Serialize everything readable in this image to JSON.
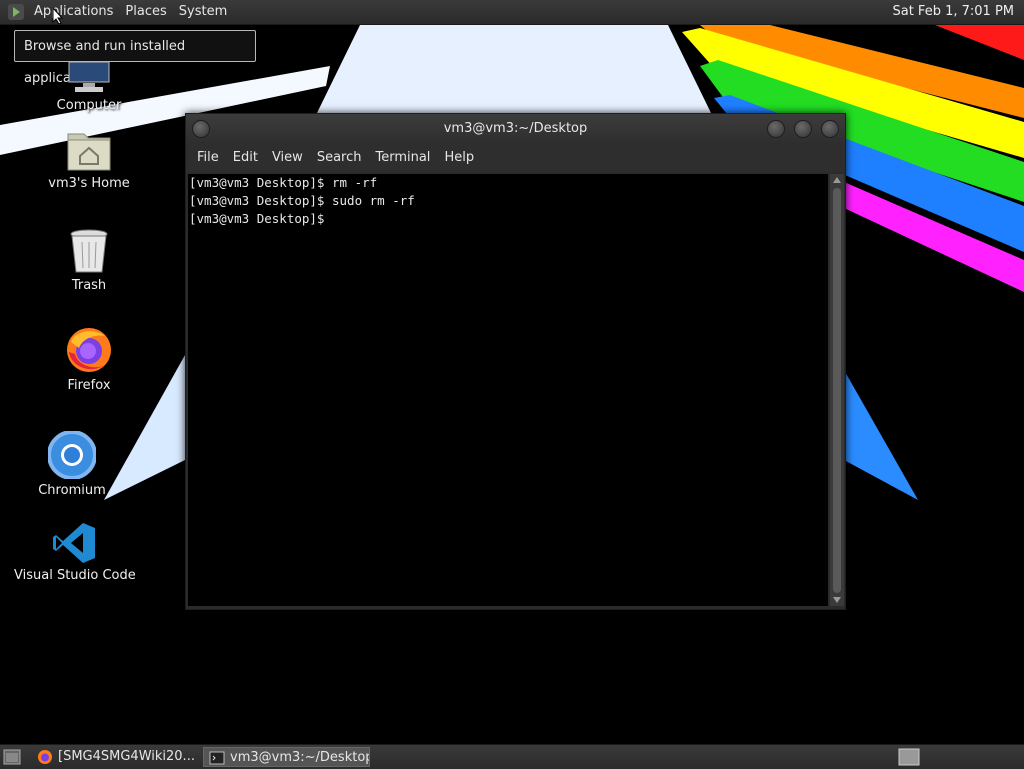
{
  "top_panel": {
    "menus": [
      "Applications",
      "Places",
      "System"
    ],
    "clock": "Sat Feb 1, 7:01 PM"
  },
  "tooltip": "Browse and run installed applications",
  "desktop_icons": [
    {
      "label": "Computer",
      "icon": "computer-icon"
    },
    {
      "label": "vm3's Home",
      "icon": "home-folder-icon"
    },
    {
      "label": "Trash",
      "icon": "trash-icon"
    },
    {
      "label": "Firefox",
      "icon": "firefox-icon"
    },
    {
      "label": "Chromium",
      "icon": "chromium-icon"
    },
    {
      "label": "Visual Studio Code",
      "icon": "vscode-icon"
    }
  ],
  "terminal": {
    "title": "vm3@vm3:~/Desktop",
    "menu": [
      "File",
      "Edit",
      "View",
      "Search",
      "Terminal",
      "Help"
    ],
    "lines": [
      "[vm3@vm3 Desktop]$ rm -rf",
      "[vm3@vm3 Desktop]$ sudo rm -rf",
      "[vm3@vm3 Desktop]$ "
    ]
  },
  "taskbar": {
    "tasks": [
      {
        "label": "[SMG4SMG4Wiki20...",
        "icon": "firefox-icon"
      },
      {
        "label": "vm3@vm3:~/Desktop",
        "icon": "terminal-icon"
      }
    ]
  },
  "colors": {
    "panel": "#2e2e2e",
    "stripes": [
      "#ff1a1a",
      "#ff8c00",
      "#ffff00",
      "#22dd22",
      "#1e7fff",
      "#ff22ff"
    ]
  }
}
